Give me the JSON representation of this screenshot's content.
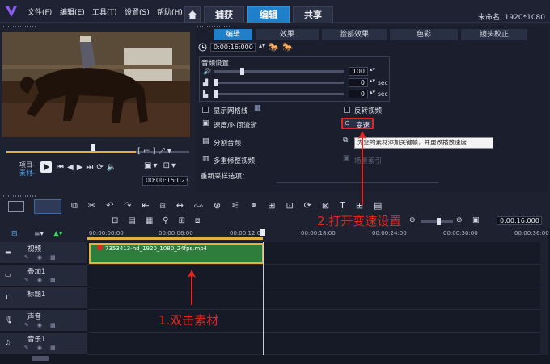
{
  "menubar": {
    "items": [
      "文件(F)",
      "编辑(E)",
      "工具(T)",
      "设置(S)",
      "帮助(H)"
    ]
  },
  "tabs": {
    "capture": "捕获",
    "edit": "编辑",
    "share": "共享"
  },
  "project_info": "未命名, 1920*1080",
  "preview": {
    "clip_label": "项目-",
    "material_label": "素材-",
    "timecode": "00:00:15:023"
  },
  "panel": {
    "tabs": [
      "编辑",
      "效果",
      "脸部效果",
      "色彩",
      "镜头校正"
    ],
    "duration": "0:00:16:000",
    "audio_settings": "音频设置",
    "volume": "100",
    "fade_in": "0",
    "fade_out": "0",
    "sec": "sec",
    "show_grid": "显示网格线",
    "reverse": "反转视频",
    "speed_time": "速度/时间流逝",
    "speed_btn": "变速",
    "split_audio": "分割音频",
    "tooltip": "为您的素材添加关键帧，并更改播放速度",
    "multi_trim": "多重修整视频",
    "split_index": "场景索引",
    "resample": "重新采样选项："
  },
  "toolbar": {
    "timecode": "0:00:16:000"
  },
  "ruler": [
    "00:00:00:00",
    "00:00:06:00",
    "00:00:12:00",
    "00:00:18:00",
    "00:00:24:00",
    "00:00:30:00",
    "00:00:36:00"
  ],
  "tracks": [
    {
      "name": "视频"
    },
    {
      "name": "叠加1"
    },
    {
      "name": "标题1"
    },
    {
      "name": "声音"
    },
    {
      "name": "音乐1"
    }
  ],
  "clip": {
    "filename": "7353413-hd_1920_1080_24fps.mp4"
  },
  "annotations": {
    "step1": "1.双击素材",
    "step2": "2.打开变速设置"
  },
  "colors": {
    "accent": "#1f7fc9",
    "annotation": "#e8241e"
  }
}
